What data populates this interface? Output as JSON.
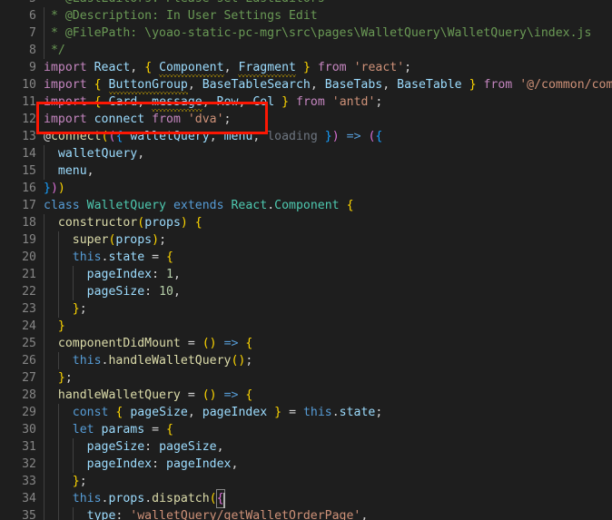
{
  "editor": {
    "language": "javascript",
    "theme": "Dark+ (default dark)",
    "background_color": "#1e1e1e",
    "gutter_color": "#858585",
    "first_visible_line": 5,
    "last_visible_line": 35
  },
  "annotation": {
    "name": "red-highlight-rectangle",
    "color": "#fc1703",
    "target_lines": [
      11,
      12
    ],
    "note": "import connect from 'dva';"
  },
  "cursor": {
    "line": 34,
    "after_text": "this.props.dispatch({"
  },
  "lines": [
    {
      "n": "5",
      "text": " * @LastEditors: Please set LastEditors"
    },
    {
      "n": "6",
      "text": " * @Description: In User Settings Edit"
    },
    {
      "n": "7",
      "text": " * @FilePath: \\yoao-static-pc-mgr\\src\\pages\\WalletQuery\\WalletQuery\\index.js"
    },
    {
      "n": "8",
      "text": " */"
    },
    {
      "n": "9",
      "text": "import React, { Component, Fragment } from 'react';"
    },
    {
      "n": "10",
      "text": "import { ButtonGroup, BaseTableSearch, BaseTabs, BaseTable } from '@/common/compon"
    },
    {
      "n": "11",
      "text": "import { Card, message, Row, Col } from 'antd';"
    },
    {
      "n": "12",
      "text": "import connect from 'dva';"
    },
    {
      "n": "13",
      "text": "@connect(({ walletQuery, menu, loading }) => ({"
    },
    {
      "n": "14",
      "text": "  walletQuery,"
    },
    {
      "n": "15",
      "text": "  menu,"
    },
    {
      "n": "16",
      "text": "}))"
    },
    {
      "n": "17",
      "text": "class WalletQuery extends React.Component {"
    },
    {
      "n": "18",
      "text": "  constructor(props) {"
    },
    {
      "n": "19",
      "text": "    super(props);"
    },
    {
      "n": "20",
      "text": "    this.state = {"
    },
    {
      "n": "21",
      "text": "      pageIndex: 1,"
    },
    {
      "n": "22",
      "text": "      pageSize: 10,"
    },
    {
      "n": "23",
      "text": "    };"
    },
    {
      "n": "24",
      "text": "  }"
    },
    {
      "n": "25",
      "text": "  componentDidMount = () => {"
    },
    {
      "n": "26",
      "text": "    this.handleWalletQuery();"
    },
    {
      "n": "27",
      "text": "  };"
    },
    {
      "n": "28",
      "text": "  handleWalletQuery = () => {"
    },
    {
      "n": "29",
      "text": "    const { pageSize, pageIndex } = this.state;"
    },
    {
      "n": "30",
      "text": "    let params = {"
    },
    {
      "n": "31",
      "text": "      pageSize: pageSize,"
    },
    {
      "n": "32",
      "text": "      pageIndex: pageIndex,"
    },
    {
      "n": "33",
      "text": "    };"
    },
    {
      "n": "34",
      "text": "    this.props.dispatch({"
    },
    {
      "n": "35",
      "text": "      type: 'walletQuery/getWalletOrderPage',"
    }
  ]
}
